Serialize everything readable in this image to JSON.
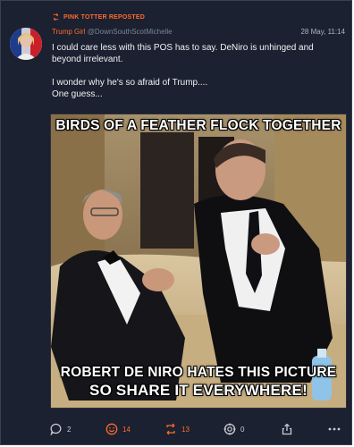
{
  "post": {
    "repost_label": "PINK TOTTER REPOSTED",
    "author_name": "Trump Girl",
    "author_handle": "@DownSouthScotMichelle",
    "date": "28 May, 11:14",
    "text_line1": "I could care less with this POS has to say. DeNiro is unhinged and beyond irrelevant.",
    "text_line2": "I wonder why he's so afraid of Trump....",
    "text_line3": "One guess..."
  },
  "meme": {
    "caption_top": "BIRDS OF A FEATHER FLOCK TOGETHER",
    "caption_bottom1": "ROBERT DE NIRO HATES THIS PICTURE",
    "caption_bottom2": "SO SHARE IT EVERYWHERE!"
  },
  "actions": {
    "replies": "2",
    "likes": "14",
    "reposts": "13",
    "quotes": "0"
  },
  "colors": {
    "accent": "#ff6a2c",
    "background": "#1b2130",
    "text": "#f1f2f4"
  },
  "icons": [
    "repost-icon",
    "reply-icon",
    "like-smiley-icon",
    "repost-arrows-icon",
    "quote-icon",
    "share-icon",
    "more-icon"
  ]
}
